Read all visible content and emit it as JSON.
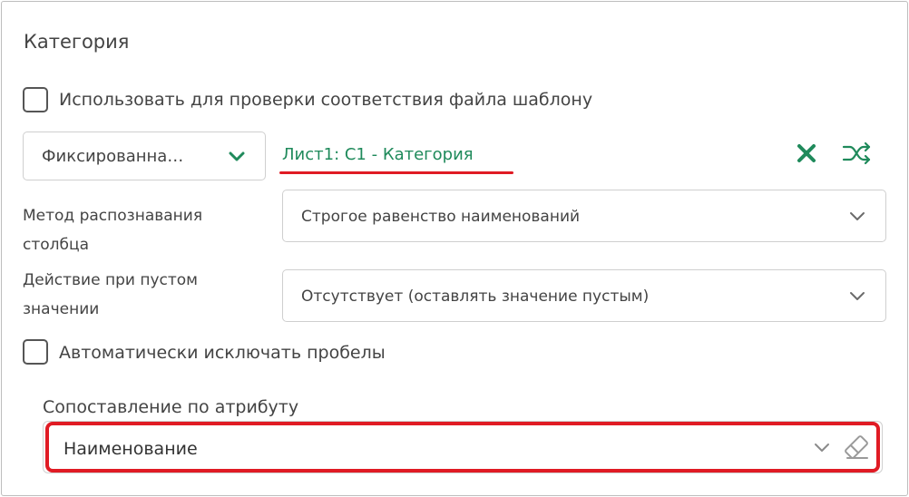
{
  "section": {
    "title": "Категория"
  },
  "checkbox_validate": {
    "label": "Использовать для проверки соответствия файла шаблону",
    "checked": false
  },
  "source": {
    "type_value": "Фиксированна…",
    "mapping_text": "Лист1: C1 - Категория"
  },
  "recognition_method": {
    "label": "Метод распознавания столбца",
    "label_line1": "Метод распознавания",
    "label_line2": "столбца",
    "value": "Строгое равенство наименований"
  },
  "empty_action": {
    "label_line1": "Действие при пустом",
    "label_line2": "значении",
    "value": "Отсутствует (оставлять значение пустым)"
  },
  "checkbox_trim": {
    "label": "Автоматически исключать пробелы",
    "checked": false
  },
  "attribute_mapping": {
    "label": "Сопоставление по атрибуту",
    "value": "Наименование"
  },
  "colors": {
    "accent_green": "#1f8a5b",
    "highlight_red": "#e01b24"
  },
  "icons": {
    "type_dropdown": "chevron-down-icon",
    "clear_mapping": "close-icon",
    "shuffle": "shuffle-icon",
    "select_dropdown": "chevron-down-icon",
    "eraser": "eraser-icon"
  }
}
